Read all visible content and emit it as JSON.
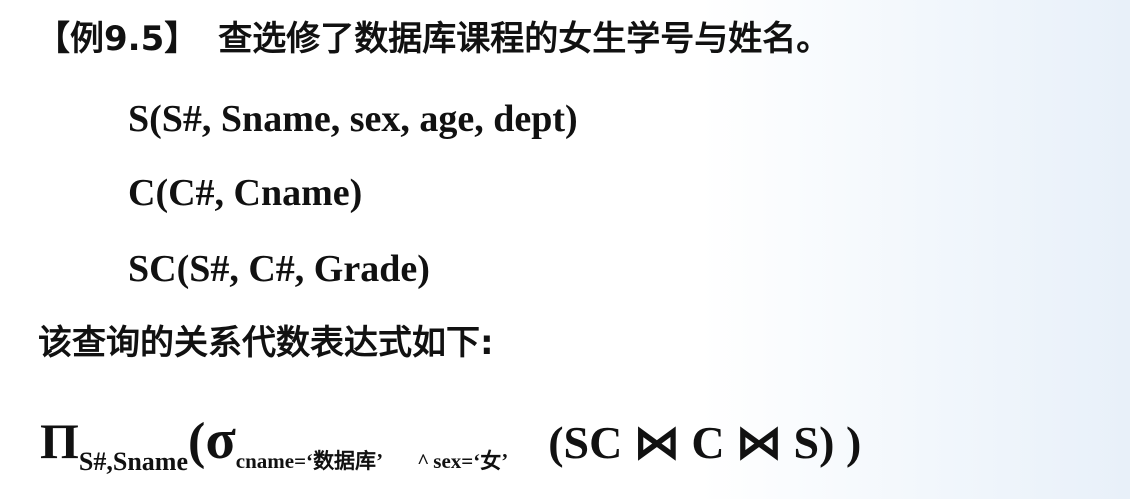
{
  "title": {
    "label": "【例9.5】",
    "text": "查选修了数据库课程的女生学号与姓名。"
  },
  "schemas": [
    "S(S#, Sname, sex, age, dept)",
    "C(C#, Cname)",
    "SC(S#, C#, Grade)"
  ],
  "intro": "该查询的关系代数表达式如下:",
  "formula": {
    "projection_symbol": "Π",
    "projection_attrs": "S#,Sname",
    "open_paren": "(",
    "selection_symbol": "σ",
    "cond_cname_prefix": "cname=‘",
    "cond_cname_value": "数据库",
    "cond_cname_suffix": "’",
    "and_operator": "^",
    "cond_sex_prefix": "sex=‘",
    "cond_sex_value": "女",
    "cond_sex_suffix": "’",
    "join_expression": "(SC ⋈ C ⋈ S) )"
  }
}
